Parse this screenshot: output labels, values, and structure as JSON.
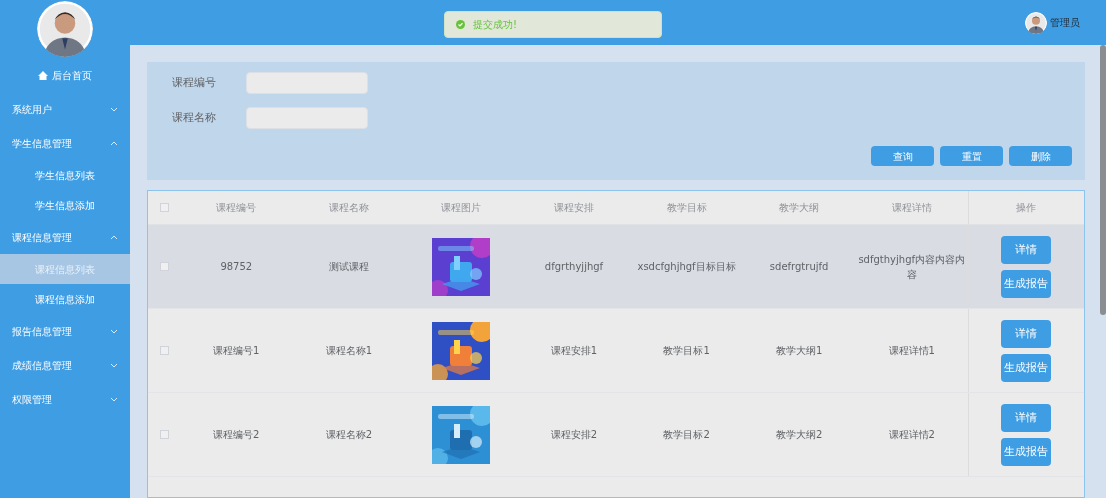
{
  "sidebar": {
    "home": "后台首页",
    "items": [
      {
        "label": "系统用户",
        "expanded": false
      },
      {
        "label": "学生信息管理",
        "expanded": true,
        "children": [
          {
            "label": "学生信息列表",
            "selected": false
          },
          {
            "label": "学生信息添加",
            "selected": false
          }
        ]
      },
      {
        "label": "课程信息管理",
        "expanded": true,
        "children": [
          {
            "label": "课程信息列表",
            "selected": true
          },
          {
            "label": "课程信息添加",
            "selected": false
          }
        ]
      },
      {
        "label": "报告信息管理",
        "expanded": false
      },
      {
        "label": "成绩信息管理",
        "expanded": false
      },
      {
        "label": "权限管理",
        "expanded": false
      }
    ]
  },
  "toast": {
    "message": "提交成功!"
  },
  "user": {
    "name": "管理员"
  },
  "search": {
    "fields": [
      {
        "label": "课程编号"
      },
      {
        "label": "课程名称"
      }
    ],
    "buttons": [
      "查询",
      "重置",
      "删除"
    ]
  },
  "table": {
    "header_checked": false,
    "columns": [
      "课程编号",
      "课程名称",
      "课程图片",
      "课程安排",
      "教学目标",
      "教学大纲",
      "课程详情",
      "操作"
    ],
    "rows": [
      {
        "checked": false,
        "hovered": true,
        "cells": [
          "98752",
          "测试课程",
          {
            "kind": "picture"
          },
          "dfgrthyjjhgf",
          "xsdcfghjhgf目标目标",
          "sdefrgtrujfd",
          "sdfgthyjhgf内容内容内容"
        ],
        "actions": [
          "详情",
          "生成报告"
        ]
      },
      {
        "checked": false,
        "hovered": false,
        "cells": [
          "课程编号1",
          "课程名称1",
          {
            "kind": "picture"
          },
          "课程安排1",
          "教学目标1",
          "教学大纲1",
          "课程详情1"
        ],
        "actions": [
          "详情",
          "生成报告"
        ]
      },
      {
        "checked": false,
        "hovered": false,
        "cells": [
          "课程编号2",
          "课程名称2",
          {
            "kind": "picture"
          },
          "课程安排2",
          "教学目标2",
          "教学大纲2",
          "课程详情2"
        ],
        "actions": [
          "详情",
          "生成报告"
        ]
      }
    ]
  }
}
